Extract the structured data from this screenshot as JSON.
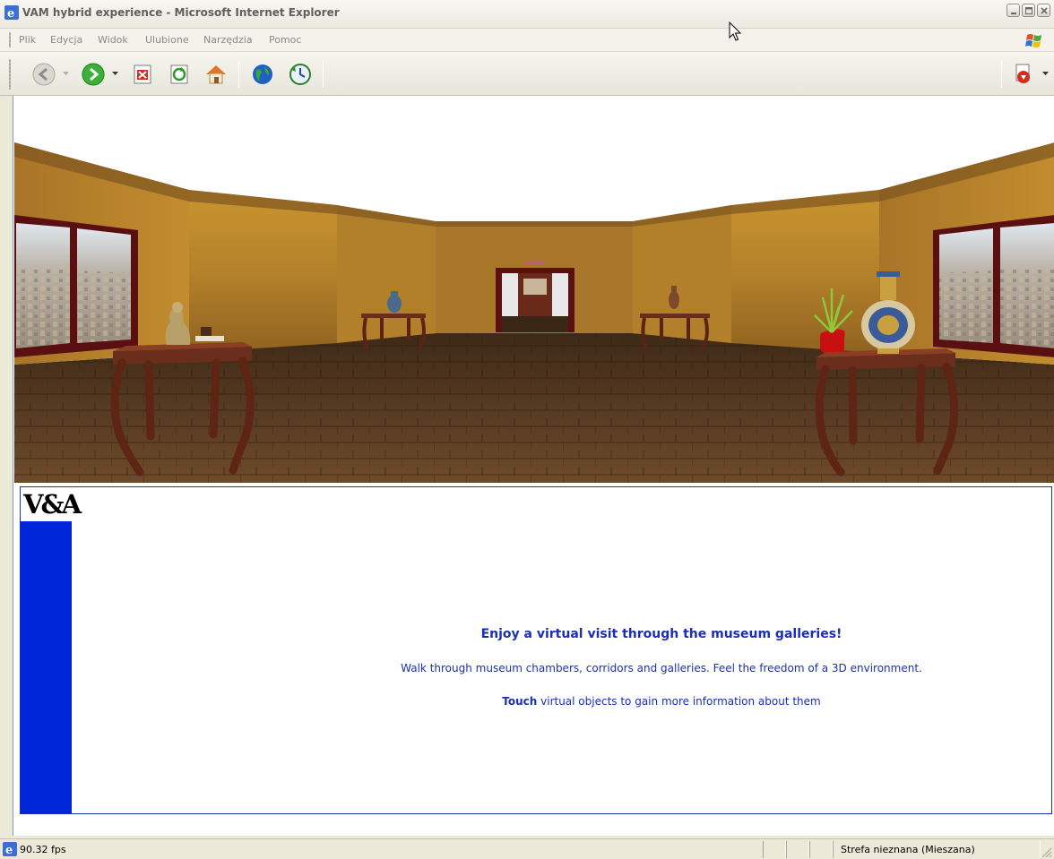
{
  "window": {
    "title": "VAM hybrid experience - Microsoft Internet Explorer",
    "app_icon": "ie-icon",
    "caption_buttons": [
      "minimize-icon",
      "maximize-icon",
      "close-icon"
    ]
  },
  "menu": {
    "items": [
      "Plik",
      "Edycja",
      "Widok",
      "Ulubione",
      "Narzędzia",
      "Pomoc"
    ]
  },
  "toolbar": {
    "buttons": [
      "back-icon",
      "forward-icon",
      "stop-icon",
      "refresh-icon",
      "home-icon",
      "internet-icon",
      "history-icon",
      "print-icon"
    ]
  },
  "scene": {
    "description_icon": "3d-museum-gallery",
    "colors": {
      "wall": "#b9862c",
      "floor": "#6b4a2a",
      "frame": "#5c1414",
      "table": "#6b2d1c"
    }
  },
  "info": {
    "logo": "V&A",
    "heading": "Enjoy a virtual visit through the museum galleries!",
    "line1": "Walk through museum chambers, corridors and galleries. Feel the freedom of a 3D environment.",
    "line2_bold": "Touch",
    "line2_rest": " virtual objects to gain more information about them",
    "colors": {
      "text": "#1a2fb8",
      "sidebar": "#0026d9"
    }
  },
  "status": {
    "fps": "90.32 fps",
    "zone": "Strefa nieznana (Mieszana)"
  }
}
